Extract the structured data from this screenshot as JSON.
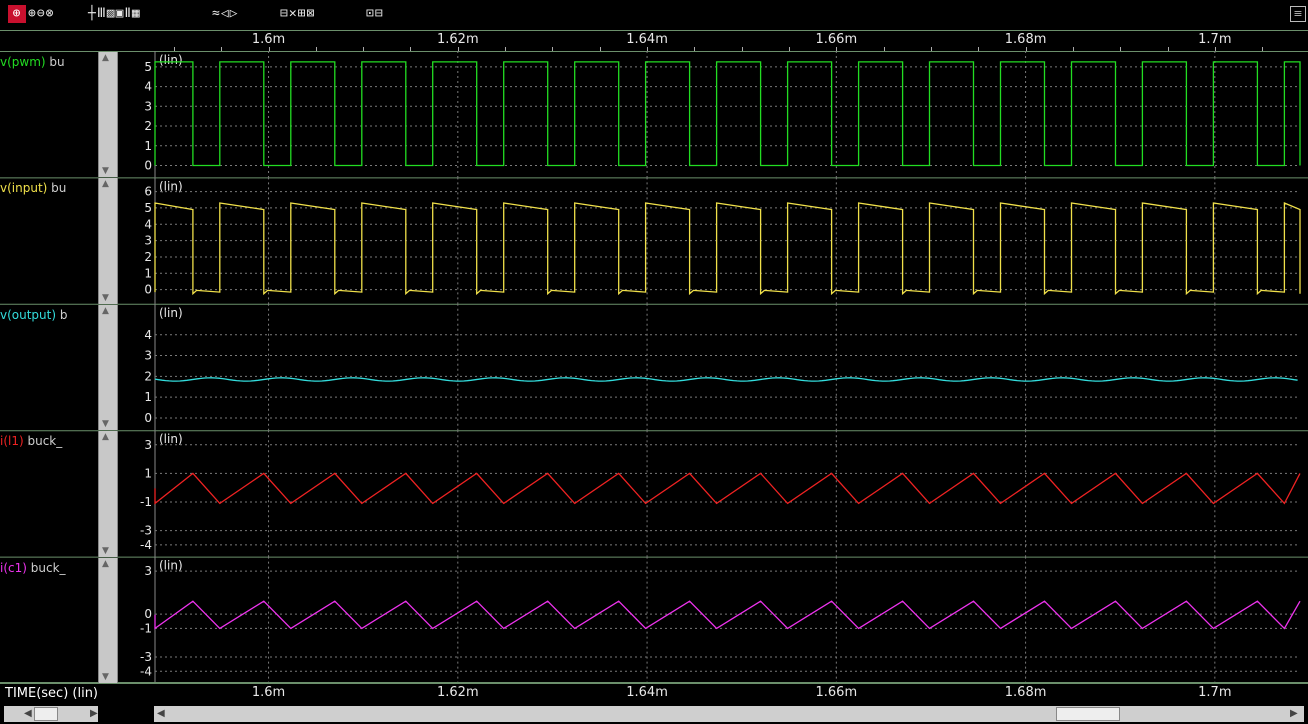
{
  "toolbar": {
    "icons": [
      "zoom-in-icon",
      "zoom-out-icon",
      "zoom-fit-icon",
      "cursor-icon",
      "bars-icon",
      "stripes-icon",
      "grid-icon"
    ],
    "group1": "⊕⊖⊗",
    "group2": "┼Ⅲ▨▣Ⅱ▦",
    "group3": "≈◁▷",
    "group4": "⊟✕⊞⊠",
    "group5": "⊡⊟",
    "menu": "≡"
  },
  "axis": {
    "label": "TIME(sec) (lin)",
    "ticks": [
      "1.6m",
      "1.62m",
      "1.64m",
      "1.66m",
      "1.68m",
      "1.7m"
    ],
    "tick_values": [
      0.0016,
      0.00162,
      0.00164,
      0.00166,
      0.00168,
      0.0017
    ],
    "xlim": [
      0.001588,
      0.001709
    ]
  },
  "colors": {
    "pwm": "#22dd22",
    "input": "#f0e04a",
    "output": "#33dddd",
    "il1": "#ee2222",
    "ic1": "#ee33ee",
    "grid": "#7a7a7a",
    "border": "#6b8f6b"
  },
  "chart_data": [
    {
      "type": "line",
      "name": "v(pwm)",
      "label_prefix": "v(pwm)",
      "label_suffix": " bu",
      "scale": "(lin)",
      "ylim": [
        -0.3,
        5.5
      ],
      "yticks": [
        "5",
        "4",
        "3",
        "2",
        "1",
        "0"
      ],
      "ytick_values": [
        5,
        4,
        3,
        2,
        1,
        0
      ],
      "period_s": 7.5e-06,
      "duty": 0.62,
      "high": 5.25,
      "low": 0.0,
      "color_key": "pwm"
    },
    {
      "type": "line",
      "name": "v(input)",
      "label_prefix": "v(input)",
      "label_suffix": " bu",
      "scale": "(lin)",
      "ylim": [
        -0.5,
        6.5
      ],
      "yticks": [
        "6",
        "5",
        "4",
        "3",
        "2",
        "1",
        "0"
      ],
      "ytick_values": [
        6,
        5,
        4,
        3,
        2,
        1,
        0
      ],
      "period_s": 7.5e-06,
      "duty": 0.62,
      "high": 5.2,
      "low": -0.25,
      "color_key": "input"
    },
    {
      "type": "line",
      "name": "v(output)",
      "label_prefix": "v(output)",
      "label_suffix": " b",
      "scale": "(lin)",
      "ylim": [
        -0.3,
        5.2
      ],
      "yticks": [
        "4",
        "3",
        "2",
        "1",
        "0"
      ],
      "ytick_values": [
        4,
        3,
        2,
        1,
        0
      ],
      "mean": 1.85,
      "ripple": 0.08,
      "color_key": "output"
    },
    {
      "type": "line",
      "name": "i(l1)",
      "label_prefix": "i(l1)",
      "label_suffix": " buck_",
      "scale": "(lin)",
      "ylim": [
        -4.4,
        3.6
      ],
      "yticks": [
        "3",
        "1",
        "-1",
        "-3",
        "-4"
      ],
      "ytick_values": [
        3,
        1,
        -1,
        -3,
        -4
      ],
      "peak": 1.0,
      "trough": -1.1,
      "color_key": "il1"
    },
    {
      "type": "line",
      "name": "i(c1)",
      "label_prefix": "i(c1)",
      "label_suffix": " buck_",
      "scale": "(lin)",
      "ylim": [
        -4.4,
        3.6
      ],
      "yticks": [
        "3",
        "0",
        "-1",
        "-3",
        "-4"
      ],
      "ytick_values": [
        3,
        0,
        -1,
        -3,
        -4
      ],
      "peak": 0.9,
      "trough": -1.0,
      "color_key": "ic1"
    }
  ]
}
